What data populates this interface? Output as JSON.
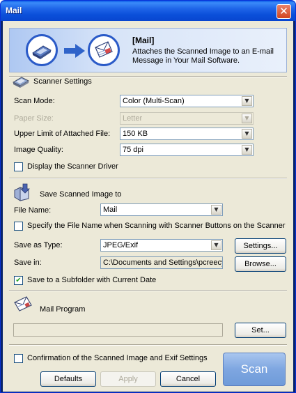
{
  "window": {
    "title": "Mail",
    "close_symbol": "✕"
  },
  "banner": {
    "title": "[Mail]",
    "description": "Attaches the Scanned Image to an E-mail Message in Your Mail Software."
  },
  "scanner_settings": {
    "heading": "Scanner Settings",
    "scan_mode": {
      "label": "Scan Mode:",
      "value": "Color (Multi-Scan)"
    },
    "paper_size": {
      "label": "Paper Size:",
      "value": "Letter"
    },
    "upper_limit": {
      "label": "Upper Limit of Attached File:",
      "value": "150 KB"
    },
    "image_quality": {
      "label": "Image Quality:",
      "value": "75 dpi"
    },
    "display_driver": {
      "label": "Display the Scanner Driver",
      "checked": false
    }
  },
  "save_settings": {
    "heading": "Save Scanned Image to",
    "file_name": {
      "label": "File Name:",
      "value": "Mail"
    },
    "specify_name": {
      "label": "Specify the File Name when Scanning with Scanner Buttons on the Scanner",
      "checked": false
    },
    "save_as_type": {
      "label": "Save as Type:",
      "value": "JPEG/Exif",
      "button": "Settings..."
    },
    "save_in": {
      "label": "Save in:",
      "value": "C:\\Documents and Settings\\pcreecy\\",
      "button": "Browse..."
    },
    "subfolder": {
      "label": "Save to a Subfolder with Current Date",
      "checked": true,
      "mark": "✔"
    }
  },
  "mail_program": {
    "heading": "Mail Program",
    "value": "",
    "button": "Set..."
  },
  "footer": {
    "confirmation": {
      "label": "Confirmation of the Scanned Image and Exif Settings",
      "checked": false
    },
    "defaults_button": "Defaults",
    "apply_button": "Apply",
    "cancel_button": "Cancel",
    "scan_button": "Scan"
  },
  "arrow_symbol": "▼"
}
